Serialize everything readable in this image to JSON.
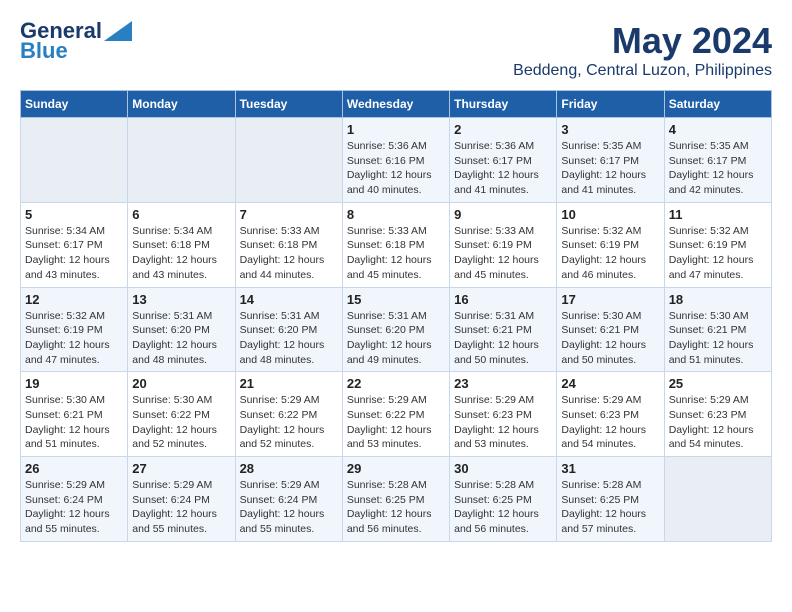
{
  "header": {
    "logo_line1": "General",
    "logo_line2": "Blue",
    "month": "May 2024",
    "location": "Beddeng, Central Luzon, Philippines"
  },
  "weekdays": [
    "Sunday",
    "Monday",
    "Tuesday",
    "Wednesday",
    "Thursday",
    "Friday",
    "Saturday"
  ],
  "weeks": [
    [
      {
        "day": "",
        "info": ""
      },
      {
        "day": "",
        "info": ""
      },
      {
        "day": "",
        "info": ""
      },
      {
        "day": "1",
        "info": "Sunrise: 5:36 AM\nSunset: 6:16 PM\nDaylight: 12 hours\nand 40 minutes."
      },
      {
        "day": "2",
        "info": "Sunrise: 5:36 AM\nSunset: 6:17 PM\nDaylight: 12 hours\nand 41 minutes."
      },
      {
        "day": "3",
        "info": "Sunrise: 5:35 AM\nSunset: 6:17 PM\nDaylight: 12 hours\nand 41 minutes."
      },
      {
        "day": "4",
        "info": "Sunrise: 5:35 AM\nSunset: 6:17 PM\nDaylight: 12 hours\nand 42 minutes."
      }
    ],
    [
      {
        "day": "5",
        "info": "Sunrise: 5:34 AM\nSunset: 6:17 PM\nDaylight: 12 hours\nand 43 minutes."
      },
      {
        "day": "6",
        "info": "Sunrise: 5:34 AM\nSunset: 6:18 PM\nDaylight: 12 hours\nand 43 minutes."
      },
      {
        "day": "7",
        "info": "Sunrise: 5:33 AM\nSunset: 6:18 PM\nDaylight: 12 hours\nand 44 minutes."
      },
      {
        "day": "8",
        "info": "Sunrise: 5:33 AM\nSunset: 6:18 PM\nDaylight: 12 hours\nand 45 minutes."
      },
      {
        "day": "9",
        "info": "Sunrise: 5:33 AM\nSunset: 6:19 PM\nDaylight: 12 hours\nand 45 minutes."
      },
      {
        "day": "10",
        "info": "Sunrise: 5:32 AM\nSunset: 6:19 PM\nDaylight: 12 hours\nand 46 minutes."
      },
      {
        "day": "11",
        "info": "Sunrise: 5:32 AM\nSunset: 6:19 PM\nDaylight: 12 hours\nand 47 minutes."
      }
    ],
    [
      {
        "day": "12",
        "info": "Sunrise: 5:32 AM\nSunset: 6:19 PM\nDaylight: 12 hours\nand 47 minutes."
      },
      {
        "day": "13",
        "info": "Sunrise: 5:31 AM\nSunset: 6:20 PM\nDaylight: 12 hours\nand 48 minutes."
      },
      {
        "day": "14",
        "info": "Sunrise: 5:31 AM\nSunset: 6:20 PM\nDaylight: 12 hours\nand 48 minutes."
      },
      {
        "day": "15",
        "info": "Sunrise: 5:31 AM\nSunset: 6:20 PM\nDaylight: 12 hours\nand 49 minutes."
      },
      {
        "day": "16",
        "info": "Sunrise: 5:31 AM\nSunset: 6:21 PM\nDaylight: 12 hours\nand 50 minutes."
      },
      {
        "day": "17",
        "info": "Sunrise: 5:30 AM\nSunset: 6:21 PM\nDaylight: 12 hours\nand 50 minutes."
      },
      {
        "day": "18",
        "info": "Sunrise: 5:30 AM\nSunset: 6:21 PM\nDaylight: 12 hours\nand 51 minutes."
      }
    ],
    [
      {
        "day": "19",
        "info": "Sunrise: 5:30 AM\nSunset: 6:21 PM\nDaylight: 12 hours\nand 51 minutes."
      },
      {
        "day": "20",
        "info": "Sunrise: 5:30 AM\nSunset: 6:22 PM\nDaylight: 12 hours\nand 52 minutes."
      },
      {
        "day": "21",
        "info": "Sunrise: 5:29 AM\nSunset: 6:22 PM\nDaylight: 12 hours\nand 52 minutes."
      },
      {
        "day": "22",
        "info": "Sunrise: 5:29 AM\nSunset: 6:22 PM\nDaylight: 12 hours\nand 53 minutes."
      },
      {
        "day": "23",
        "info": "Sunrise: 5:29 AM\nSunset: 6:23 PM\nDaylight: 12 hours\nand 53 minutes."
      },
      {
        "day": "24",
        "info": "Sunrise: 5:29 AM\nSunset: 6:23 PM\nDaylight: 12 hours\nand 54 minutes."
      },
      {
        "day": "25",
        "info": "Sunrise: 5:29 AM\nSunset: 6:23 PM\nDaylight: 12 hours\nand 54 minutes."
      }
    ],
    [
      {
        "day": "26",
        "info": "Sunrise: 5:29 AM\nSunset: 6:24 PM\nDaylight: 12 hours\nand 55 minutes."
      },
      {
        "day": "27",
        "info": "Sunrise: 5:29 AM\nSunset: 6:24 PM\nDaylight: 12 hours\nand 55 minutes."
      },
      {
        "day": "28",
        "info": "Sunrise: 5:29 AM\nSunset: 6:24 PM\nDaylight: 12 hours\nand 55 minutes."
      },
      {
        "day": "29",
        "info": "Sunrise: 5:28 AM\nSunset: 6:25 PM\nDaylight: 12 hours\nand 56 minutes."
      },
      {
        "day": "30",
        "info": "Sunrise: 5:28 AM\nSunset: 6:25 PM\nDaylight: 12 hours\nand 56 minutes."
      },
      {
        "day": "31",
        "info": "Sunrise: 5:28 AM\nSunset: 6:25 PM\nDaylight: 12 hours\nand 57 minutes."
      },
      {
        "day": "",
        "info": ""
      }
    ]
  ]
}
